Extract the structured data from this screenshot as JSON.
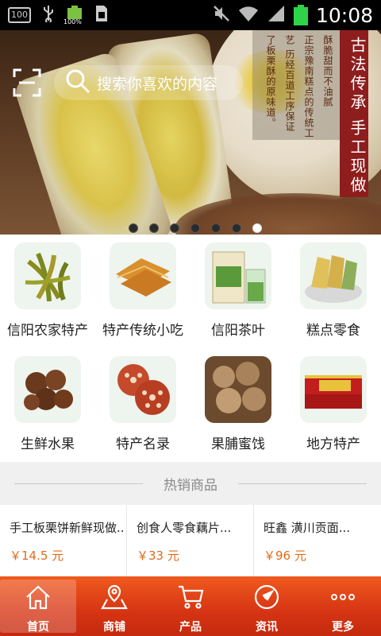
{
  "status_bar": {
    "left_badge": "100",
    "battery_small_pct": "100%",
    "time": "10:08",
    "icons": [
      "storage-icon",
      "usb-icon",
      "battery-icon",
      "sim-icon",
      "mute-icon",
      "wifi-icon",
      "signal-icon",
      "battery-icon"
    ]
  },
  "banner": {
    "search_placeholder": "搜索你喜欢的内容",
    "ribbon_text": [
      "古法传承",
      "手工现做"
    ],
    "poem_lines": [
      "酥脆甜而不油腻",
      "正宗豫南糕点的传统工",
      "艺 历经百道工序保证",
      "了板栗酥的原味道。"
    ],
    "dots_count": 7,
    "active_dot": 6
  },
  "categories": [
    {
      "label": "信阳农家特产",
      "icon": "pickled-vegetable-icon"
    },
    {
      "label": "特产传统小吃",
      "icon": "crisps-icon"
    },
    {
      "label": "信阳茶叶",
      "icon": "tea-icon"
    },
    {
      "label": "糕点零食",
      "icon": "pastry-icon"
    },
    {
      "label": "生鲜水果",
      "icon": "chestnut-icon"
    },
    {
      "label": "特产名录",
      "icon": "lotus-root-icon"
    },
    {
      "label": "果脯蜜饯",
      "icon": "dried-fruit-icon"
    },
    {
      "label": "地方特产",
      "icon": "gift-box-icon"
    }
  ],
  "hot": {
    "title": "热销商品"
  },
  "products": [
    {
      "name": "手工板栗饼新鲜现做...",
      "price": "￥14.5 元"
    },
    {
      "name": "创食人零食藕片...",
      "price": "￥33 元"
    },
    {
      "name": "旺鑫 潢川贡面...",
      "price": "￥96 元"
    }
  ],
  "tabbar": {
    "tabs": [
      {
        "label": "首页",
        "icon": "home-icon"
      },
      {
        "label": "商铺",
        "icon": "store-map-icon"
      },
      {
        "label": "产品",
        "icon": "cart-icon"
      },
      {
        "label": "资讯",
        "icon": "compass-icon"
      },
      {
        "label": "更多",
        "icon": "more-icon"
      }
    ],
    "active_index": 0
  },
  "colors": {
    "tabbar_top": "#f05a1e",
    "tabbar_bottom": "#c42a0e",
    "price": "#e06a1a",
    "ribbon": "#8e1d1d"
  }
}
